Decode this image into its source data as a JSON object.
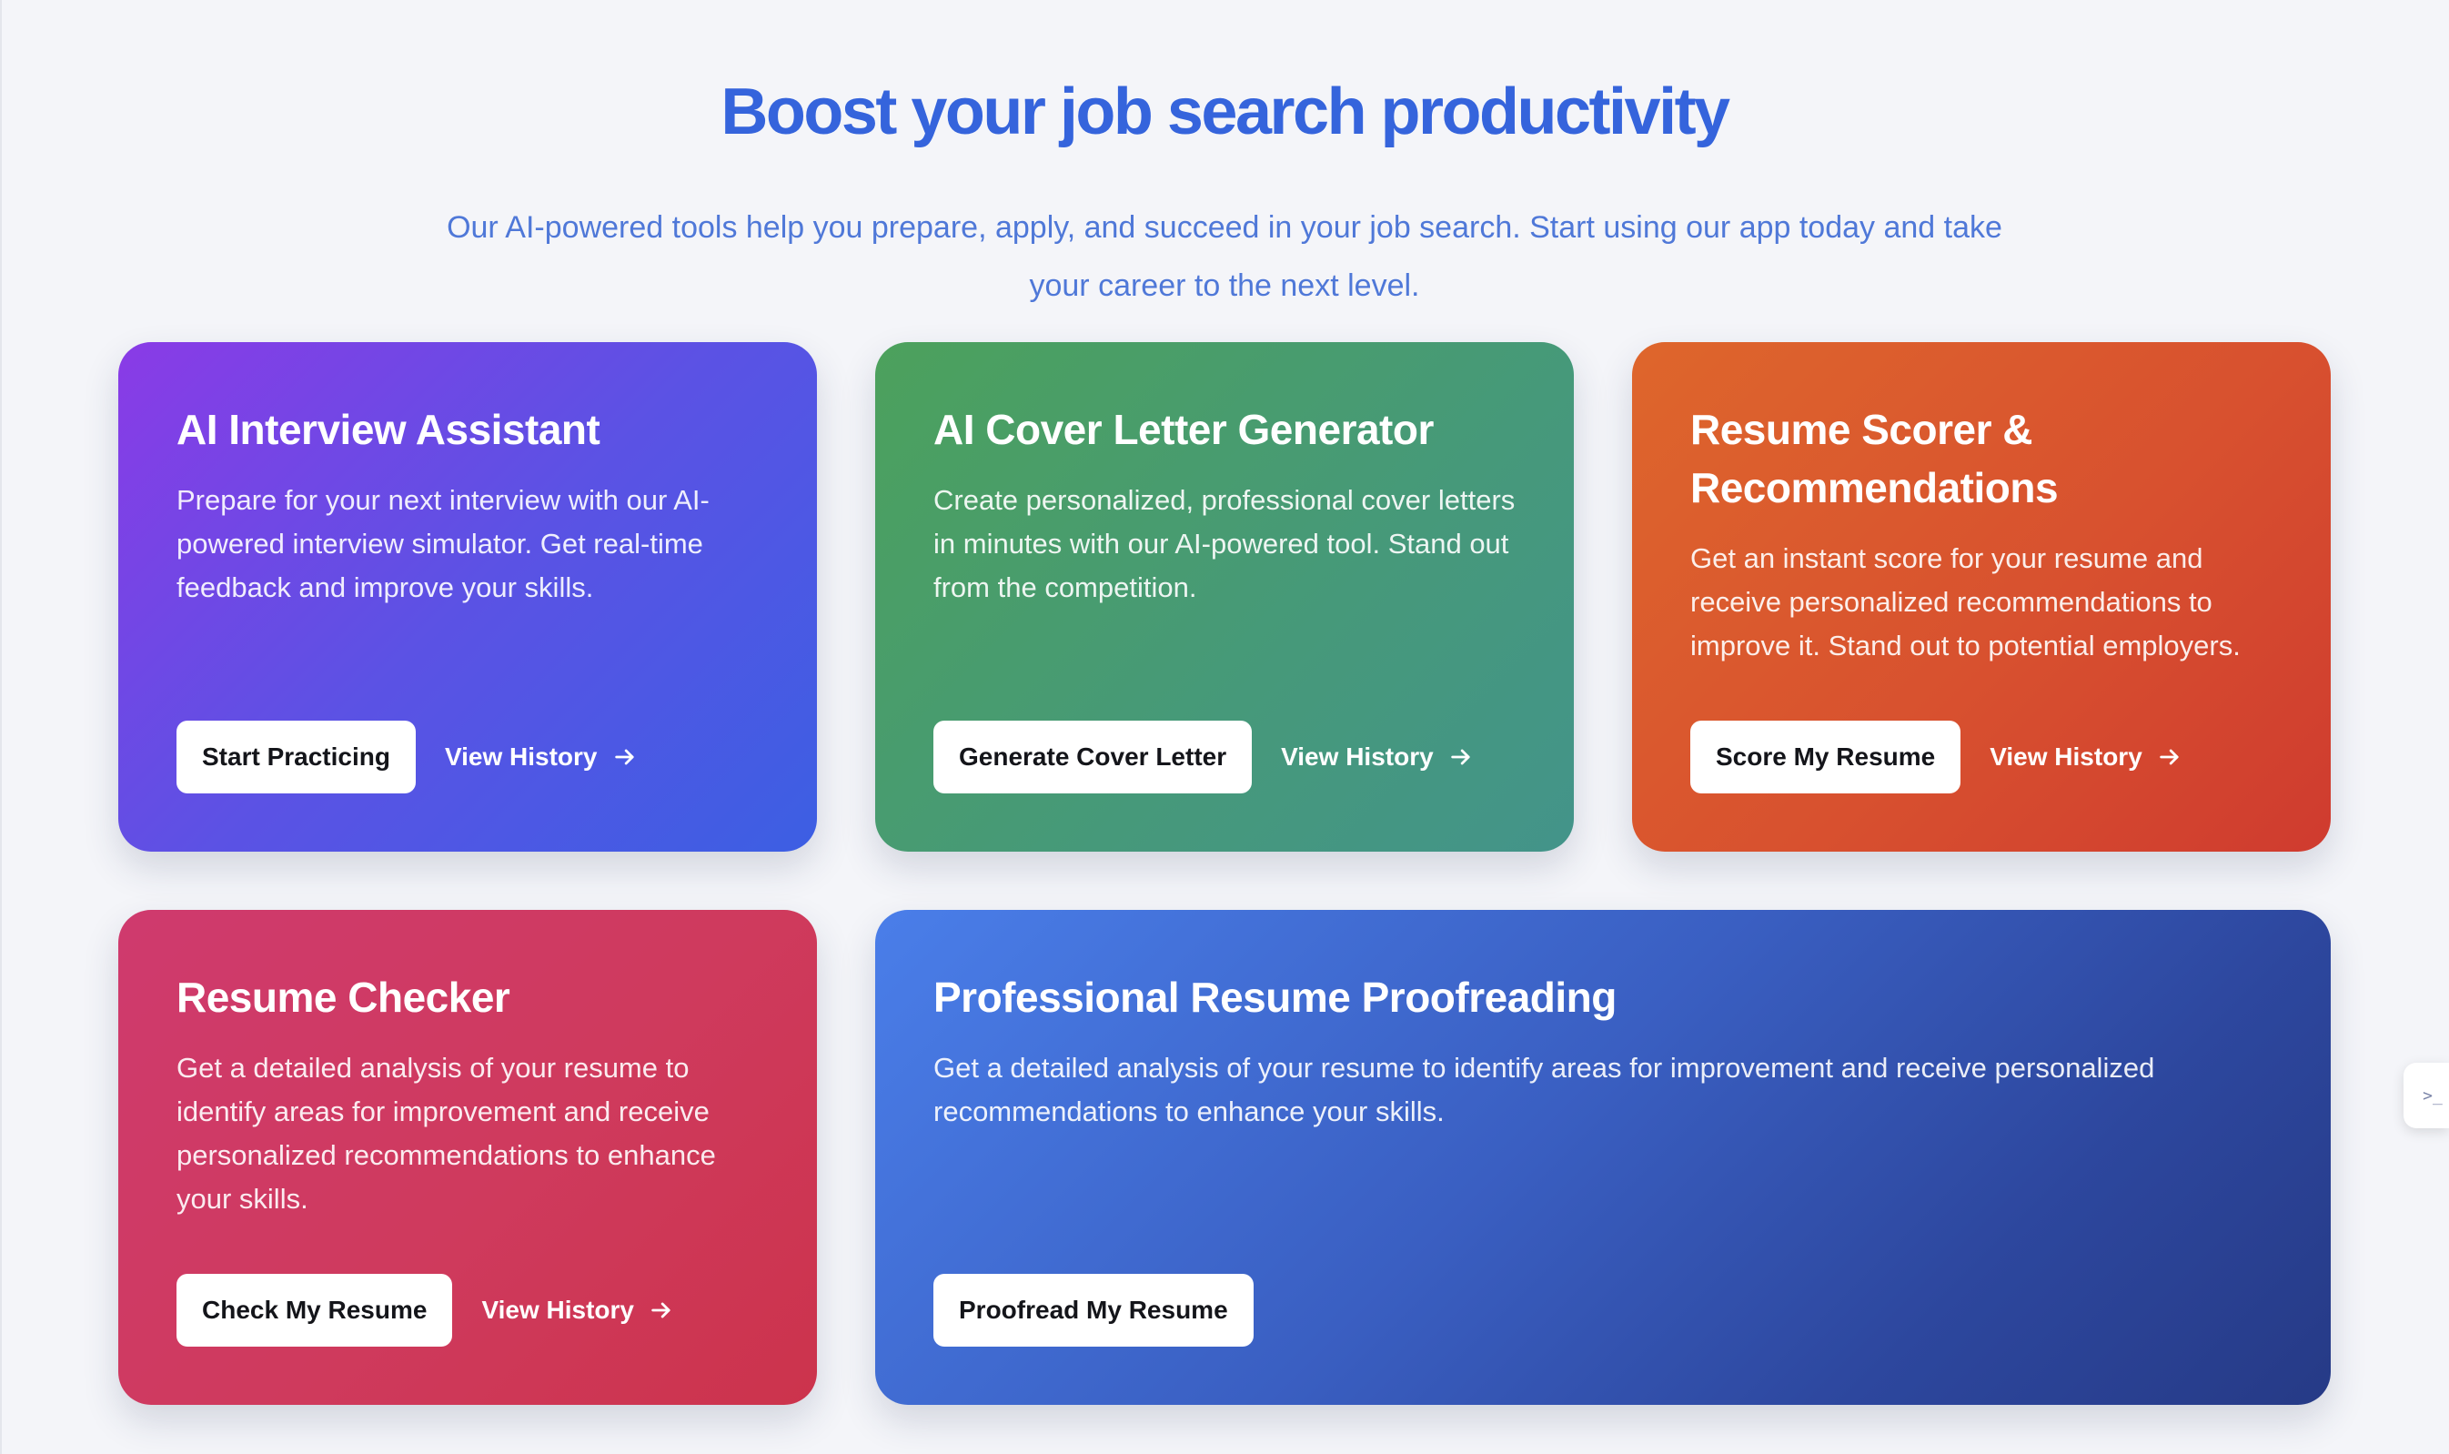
{
  "header": {
    "title": "Boost your job search productivity",
    "subtitle": "Our AI-powered tools help you prepare, apply, and succeed in your job search. Start using our app today and take your career to the next level."
  },
  "cards": [
    {
      "title": "AI Interview Assistant",
      "description": "Prepare for your next interview with our AI-powered interview simulator. Get real-time feedback and improve your skills.",
      "primary_label": "Start Practicing",
      "history_label": "View History",
      "history_icon": "arrow-right-icon"
    },
    {
      "title": "AI Cover Letter Generator",
      "description": "Create personalized, professional cover letters in minutes with our AI-powered tool. Stand out from the competition.",
      "primary_label": "Generate Cover Letter",
      "history_label": "View History",
      "history_icon": "arrow-right-icon"
    },
    {
      "title": "Resume Scorer & Recommendations",
      "description": "Get an instant score for your resume and receive personalized recommendations to improve it. Stand out to potential employers.",
      "primary_label": "Score My Resume",
      "history_label": "View History",
      "history_icon": "arrow-right-icon"
    },
    {
      "title": "Resume Checker",
      "description": "Get a detailed analysis of your resume to identify areas for improvement and receive personalized recommendations to enhance your skills.",
      "primary_label": "Check My Resume",
      "history_label": "View History",
      "history_icon": "arrow-right-icon"
    },
    {
      "title": "Professional Resume Proofreading",
      "description": "Get a detailed analysis of your resume to identify areas for improvement and receive personalized recommendations to enhance your skills.",
      "primary_label": "Proofread My Resume"
    }
  ],
  "side_widget": {
    "label": ">_"
  },
  "colors": {
    "heading": "#3564dc",
    "subheading": "#4f78d8",
    "background": "#f4f5f9",
    "card_interview": "#6a4ae5",
    "card_cover_letter": "#4a9c6e",
    "card_scorer": "#d8512f",
    "card_checker": "#cf3a5d",
    "card_proofreading": "#3a5fc2"
  }
}
